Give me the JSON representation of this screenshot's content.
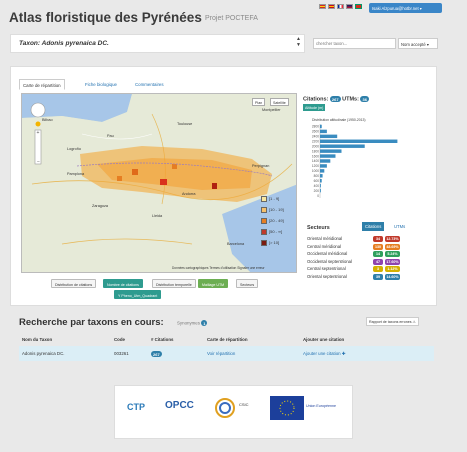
{
  "header": {
    "title": "Atlas floristique des Pyrénées",
    "subtitle": "Projet POCTEFA",
    "user_button": "Isaki Alzpurua@hotbr.net ▾"
  },
  "taxon_bar": {
    "label": "Taxon: Adonis pyrenaica DC."
  },
  "search": {
    "placeholder": "chercher taxon...",
    "select_value": "Nom accepté ▾"
  },
  "tabs": [
    "Carte de répartition",
    "Fiche biologique",
    "Commentaires"
  ],
  "map": {
    "type_buttons": [
      "Plan",
      "Satellite"
    ],
    "cities": [
      "Bilbao",
      "Logroño",
      "Zaragoza",
      "Lleida",
      "Barcelona",
      "Toulouse",
      "Pau",
      "Montpellier",
      "Pamplona",
      "Perpignan",
      "Andorra"
    ],
    "legend": [
      "[1 - 9]",
      "[10 - 19]",
      "[20 - 49]",
      "[50 - ∞]",
      "[> 10]"
    ],
    "footer": "Données cartographiques    Termes d'utilisation    Signaler une erreur"
  },
  "map_buttons": [
    "Distribution de citations",
    "Nombre de citations",
    "Distribution temporelle",
    "Maillage UTM",
    "Secteurs",
    "Y Pheno_Utm_Quadrant"
  ],
  "citations": {
    "label": "Citations:",
    "count": "267",
    "utm_label": "UTMs:",
    "utm_count": "36",
    "dist_button": "Altitude (m)"
  },
  "chart_data": {
    "type": "bar",
    "title": "Distribution altitudinale (1950-2013)",
    "categories": [
      "2800",
      "2600",
      "2400",
      "2200",
      "2000",
      "1800",
      "1600",
      "1400",
      "1200",
      "1000",
      "800",
      "600",
      "400",
      "200",
      "0"
    ],
    "values": [
      2,
      8,
      20,
      90,
      52,
      25,
      18,
      12,
      8,
      5,
      3,
      2,
      1,
      1,
      0
    ],
    "xlim": [
      0,
      100
    ]
  },
  "sectors": {
    "title": "Secteurs",
    "tabs": [
      "Citations",
      "UTMs"
    ],
    "rows": [
      {
        "name": "Oriental méridional",
        "count": "34",
        "pct": "12.73%",
        "color": "#c0392b"
      },
      {
        "name": "Central méridional",
        "count": "130",
        "pct": "48.69%",
        "color": "#e67e22"
      },
      {
        "name": "Occidental méridional",
        "count": "14",
        "pct": "5.24%",
        "color": "#2ea05d"
      },
      {
        "name": "Occidental septentrional",
        "count": "47",
        "pct": "17.60%",
        "color": "#8e44ad"
      },
      {
        "name": "Central septentrional",
        "count": "3",
        "pct": "1.12%",
        "color": "#d4b100"
      },
      {
        "name": "Oriental septentrional",
        "count": "39",
        "pct": "14.60%",
        "color": "#2e7fa9"
      }
    ]
  },
  "results": {
    "title": "Recherche par taxons en cours:",
    "synonyms_label": "Synonymes",
    "synonyms_count": "1",
    "report_button": "Rapport de taxons errones ⚠",
    "columns": [
      "Nom du Taxon",
      "Code",
      "# Citations",
      "Carte de répartition",
      "Ajouter une citation"
    ],
    "row": {
      "name": "Adonis pyrenaica DC.",
      "code": "003261",
      "citations": "267",
      "map_link": "Voir répartition",
      "add_link": "Ajouter une citation ✚"
    }
  },
  "footer": {
    "logos": [
      "CTP",
      "OPCC",
      "CSIC",
      "Union Européenne"
    ]
  }
}
